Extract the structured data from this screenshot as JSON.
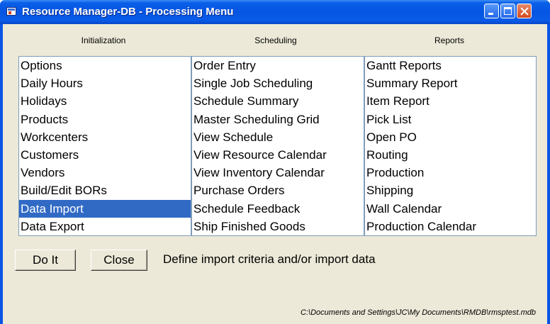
{
  "window": {
    "title": "Resource Manager-DB - Processing Menu",
    "titlebar_color": "#0a54e6"
  },
  "columns": [
    {
      "header": "Initialization",
      "items": [
        "Options",
        "Daily Hours",
        "Holidays",
        "Products",
        "Workcenters",
        "Customers",
        "Vendors",
        "Build/Edit BORs",
        "Data Import",
        "Data Export"
      ]
    },
    {
      "header": "Scheduling",
      "items": [
        "Order Entry",
        "Single Job Scheduling",
        "Schedule Summary",
        "Master Scheduling Grid",
        "View Schedule",
        "View Resource Calendar",
        "View Inventory Calendar",
        "Purchase Orders",
        "Schedule Feedback",
        "Ship Finished Goods"
      ]
    },
    {
      "header": "Reports",
      "items": [
        "Gantt Reports",
        "Summary Report",
        "Item Report",
        "Pick List",
        "Open PO",
        "Routing",
        "Production",
        "Shipping",
        "Wall Calendar",
        "Production Calendar"
      ]
    }
  ],
  "selected": {
    "column": 0,
    "item": 8
  },
  "selection_color": "#316ac5",
  "buttons": {
    "do_it": "Do It",
    "close": "Close"
  },
  "status_text": "Define import criteria and/or import data",
  "db_path": "C:\\Documents and Settings\\JC\\My Documents\\RMDB\\rmsptest.mdb"
}
